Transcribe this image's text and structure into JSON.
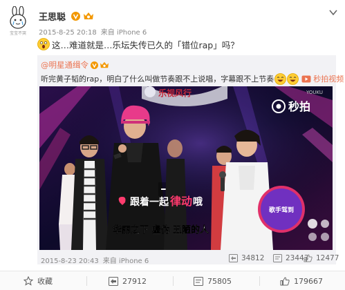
{
  "avatar": {
    "caption": "宝宝不哭"
  },
  "post": {
    "author": "王思聪",
    "time": "2015-8-25 20:18",
    "source": "来自 iPhone 6",
    "text": "这…难道就是…乐坛失传已久的「错位rap」吗？"
  },
  "retweet": {
    "author": "@明星通缉令",
    "text": "听完黄子韬的rap，明白了什么叫做节奏跟不上说唱，字幕跟不上节奏",
    "video_link": "秒拍视频",
    "time": "2015-8-23 20:43",
    "source": "来自 iPhone 6",
    "reposts": "34812",
    "comments": "23443",
    "likes": "12477",
    "video": {
      "logo": "秒拍",
      "watermark": "YOUKU",
      "sign": "乐视风行",
      "caption_top_a": "跟着一起",
      "caption_top_b": "律动",
      "caption_top_c": "哦",
      "caption_bottom": "华丽之下 虚伪 丑陋的人",
      "board": "歌手驾到"
    }
  },
  "actions": {
    "favorite": "收藏",
    "reposts": "27912",
    "comments": "75805",
    "likes": "179667"
  },
  "colors": {
    "accent": "#eb7350",
    "vip_orange": "#f39800",
    "stage": "#0c0a25"
  }
}
